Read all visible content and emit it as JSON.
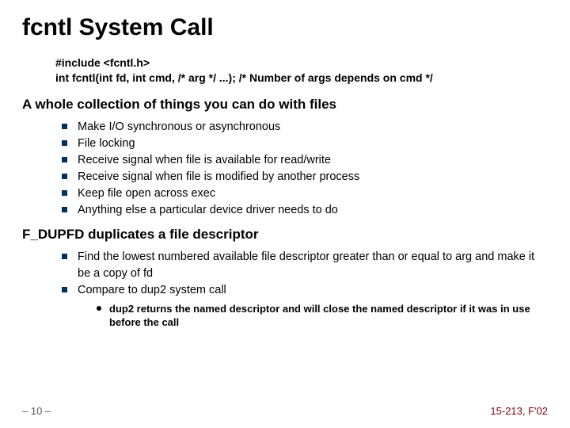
{
  "title": "fcntl System Call",
  "code": {
    "line1": "#include <fcntl.h>",
    "line2": "int fcntl(int fd, int cmd, /* arg */ ...);  /* Number of args depends on cmd */"
  },
  "section1": {
    "heading": "A whole collection of things you can do with files",
    "items": [
      "Make I/O synchronous or asynchronous",
      "File locking",
      "Receive signal when file is available for read/write",
      "Receive signal when file is modified by another process",
      "Keep file open across exec",
      "Anything else a particular device driver needs to do"
    ]
  },
  "section2": {
    "heading": "F_DUPFD duplicates a file descriptor",
    "items": [
      "Find the lowest numbered available file descriptor greater  than or equal to arg and make it be a copy of fd",
      "Compare to dup2 system call"
    ],
    "subitems": [
      "dup2 returns the named descriptor and will close the named descriptor if it was in use before the call"
    ]
  },
  "footer": {
    "page": "– 10 –",
    "course": "15-213, F'02"
  }
}
